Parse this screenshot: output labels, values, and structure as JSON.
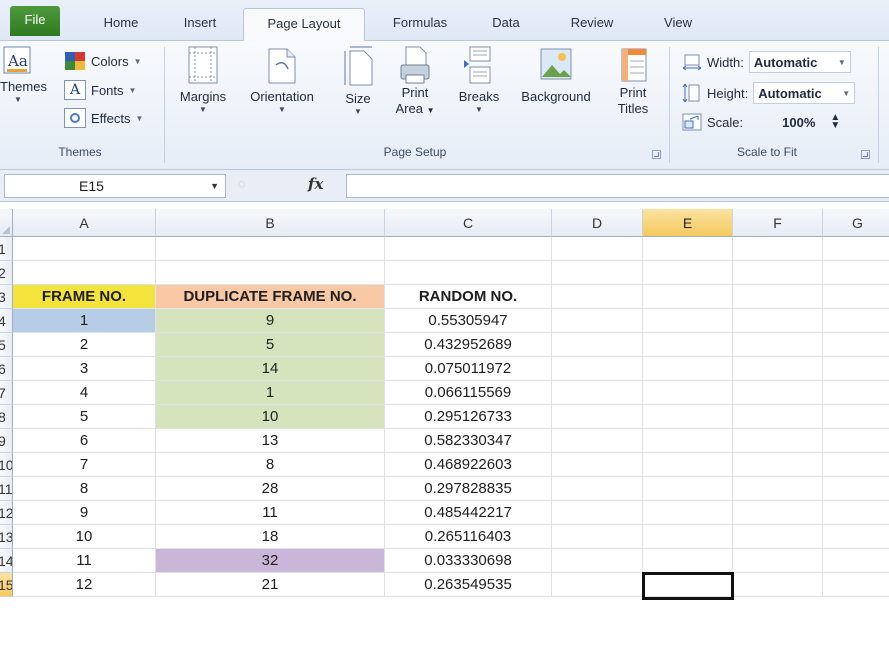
{
  "tabs": [
    "File",
    "Home",
    "Insert",
    "Page Layout",
    "Formulas",
    "Data",
    "Review",
    "View"
  ],
  "ribbon": {
    "themes_group": {
      "themes_label": "Themes",
      "colors_label": "Colors",
      "fonts_label": "Fonts",
      "effects_label": "Effects",
      "group_label": "Themes"
    },
    "page_setup_group": {
      "margins": "Margins",
      "orientation": "Orientation",
      "size": "Size",
      "print_area_1": "Print",
      "print_area_2": "Area",
      "breaks": "Breaks",
      "background": "Background",
      "print_titles_1": "Print",
      "print_titles_2": "Titles",
      "group_label": "Page Setup"
    },
    "scale_group": {
      "width_label": "Width:",
      "width_value": "Automatic",
      "height_label": "Height:",
      "height_value": "Automatic",
      "scale_label": "Scale:",
      "scale_value": "100%",
      "group_label": "Scale to Fit"
    }
  },
  "formula_bar": {
    "name_box": "E15",
    "fx": "fx",
    "formula": ""
  },
  "grid": {
    "columns": [
      "A",
      "B",
      "C",
      "D",
      "E",
      "F",
      "G"
    ],
    "selected_column": "E",
    "selected_row": "15",
    "rows": [
      {
        "num": "1",
        "a": "",
        "b": "",
        "c": ""
      },
      {
        "num": "2",
        "a": "",
        "b": "",
        "c": ""
      },
      {
        "num": "3",
        "a": "FRAME NO.",
        "b": "DUPLICATE FRAME NO.",
        "c": "RANDOM NO."
      },
      {
        "num": "4",
        "a": "1",
        "b": "9",
        "c": "0.55305947"
      },
      {
        "num": "5",
        "a": "2",
        "b": "5",
        "c": "0.432952689"
      },
      {
        "num": "6",
        "a": "3",
        "b": "14",
        "c": "0.075011972"
      },
      {
        "num": "7",
        "a": "4",
        "b": "1",
        "c": "0.066115569"
      },
      {
        "num": "8",
        "a": "5",
        "b": "10",
        "c": "0.295126733"
      },
      {
        "num": "9",
        "a": "6",
        "b": "13",
        "c": "0.582330347"
      },
      {
        "num": "10",
        "a": "7",
        "b": "8",
        "c": "0.468922603"
      },
      {
        "num": "11",
        "a": "8",
        "b": "28",
        "c": "0.297828835"
      },
      {
        "num": "12",
        "a": "9",
        "b": "11",
        "c": "0.485442217"
      },
      {
        "num": "13",
        "a": "10",
        "b": "18",
        "c": "0.265116403"
      },
      {
        "num": "14",
        "a": "11",
        "b": "32",
        "c": "0.033330698"
      },
      {
        "num": "15",
        "a": "12",
        "b": "21",
        "c": "0.263549535"
      }
    ],
    "fills": {
      "header_a": "#f3e33b",
      "header_b": "#f9c9a6",
      "a4": "#b7cce6",
      "b_green": "#d6e4bd",
      "b14": "#c9b6d9"
    }
  }
}
